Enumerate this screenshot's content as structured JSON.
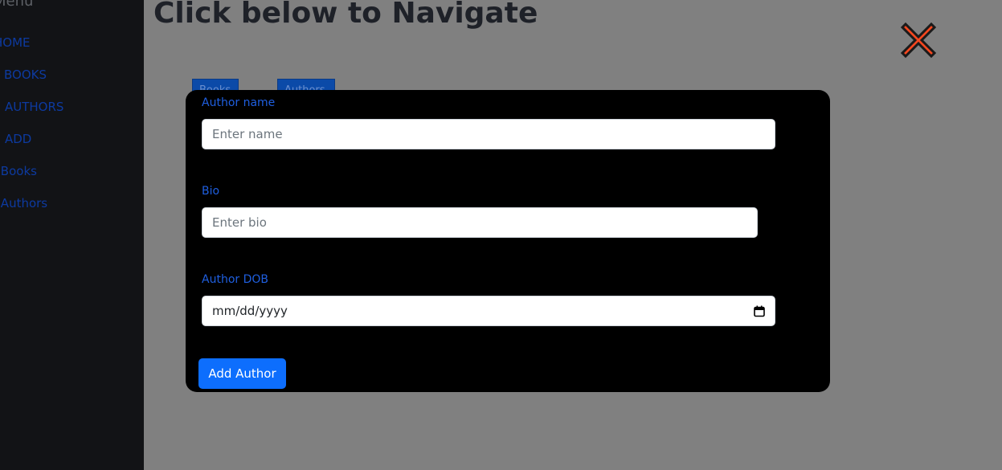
{
  "sidebar": {
    "title": "Menu",
    "items": [
      {
        "label": "HOME"
      },
      {
        "label": "BOOKS"
      },
      {
        "label": "AUTHORS"
      },
      {
        "label": "ADD"
      },
      {
        "label": "Add Books"
      },
      {
        "label": "Add Authors"
      }
    ]
  },
  "main": {
    "title": "Click below to Navigate",
    "nav_buttons": [
      {
        "label": "Books"
      },
      {
        "label": "Authors"
      }
    ]
  },
  "modal": {
    "fields": {
      "name": {
        "label": "Author name",
        "placeholder": "Enter name",
        "value": ""
      },
      "bio": {
        "label": "Bio",
        "placeholder": "Enter bio",
        "value": ""
      },
      "dob": {
        "label": "Author DOB",
        "value": "mm/dd/yyyy"
      }
    },
    "submit_label": "Add Author"
  },
  "colors": {
    "sidebar_bg": "#121316",
    "link": "#0d3aa0",
    "overlay": "#808080",
    "modal_bg": "#000000",
    "label": "#1f5fe0",
    "primary": "#0d6efd",
    "close_icon": "#f4471f"
  },
  "icons": {
    "close": "close-x-icon",
    "calendar": "calendar-icon"
  }
}
